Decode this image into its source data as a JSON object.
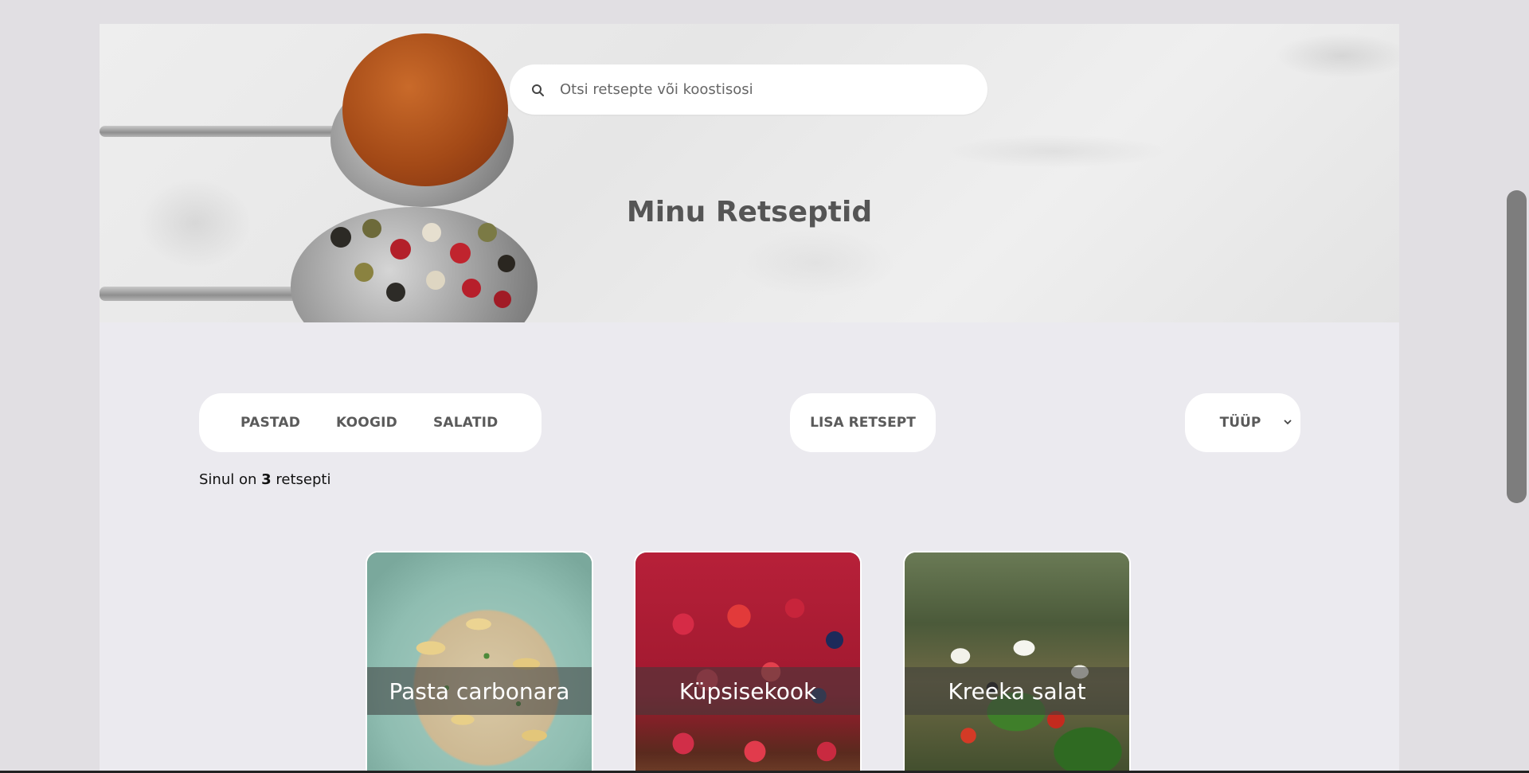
{
  "search": {
    "placeholder": "Otsi retsepte või koostisosi",
    "icon": "search-icon"
  },
  "hero": {
    "title": "Minu Retseptid"
  },
  "categories": [
    {
      "label": "PASTAD"
    },
    {
      "label": "KOOGID"
    },
    {
      "label": "SALATID"
    }
  ],
  "actions": {
    "add_recipe": "LISA RETSEPT",
    "type_select": "TÜÜP"
  },
  "count": {
    "prefix": "Sinul on",
    "value": "3",
    "suffix": "retsepti"
  },
  "recipes": [
    {
      "title": "Pasta carbonara"
    },
    {
      "title": "Küpsisekook"
    },
    {
      "title": "Kreeka salat"
    }
  ],
  "colors": {
    "page_bg": "#ebeaef",
    "outer_bg": "#e1dfe3",
    "text_dark": "#555555",
    "pill_bg": "#ffffff"
  }
}
